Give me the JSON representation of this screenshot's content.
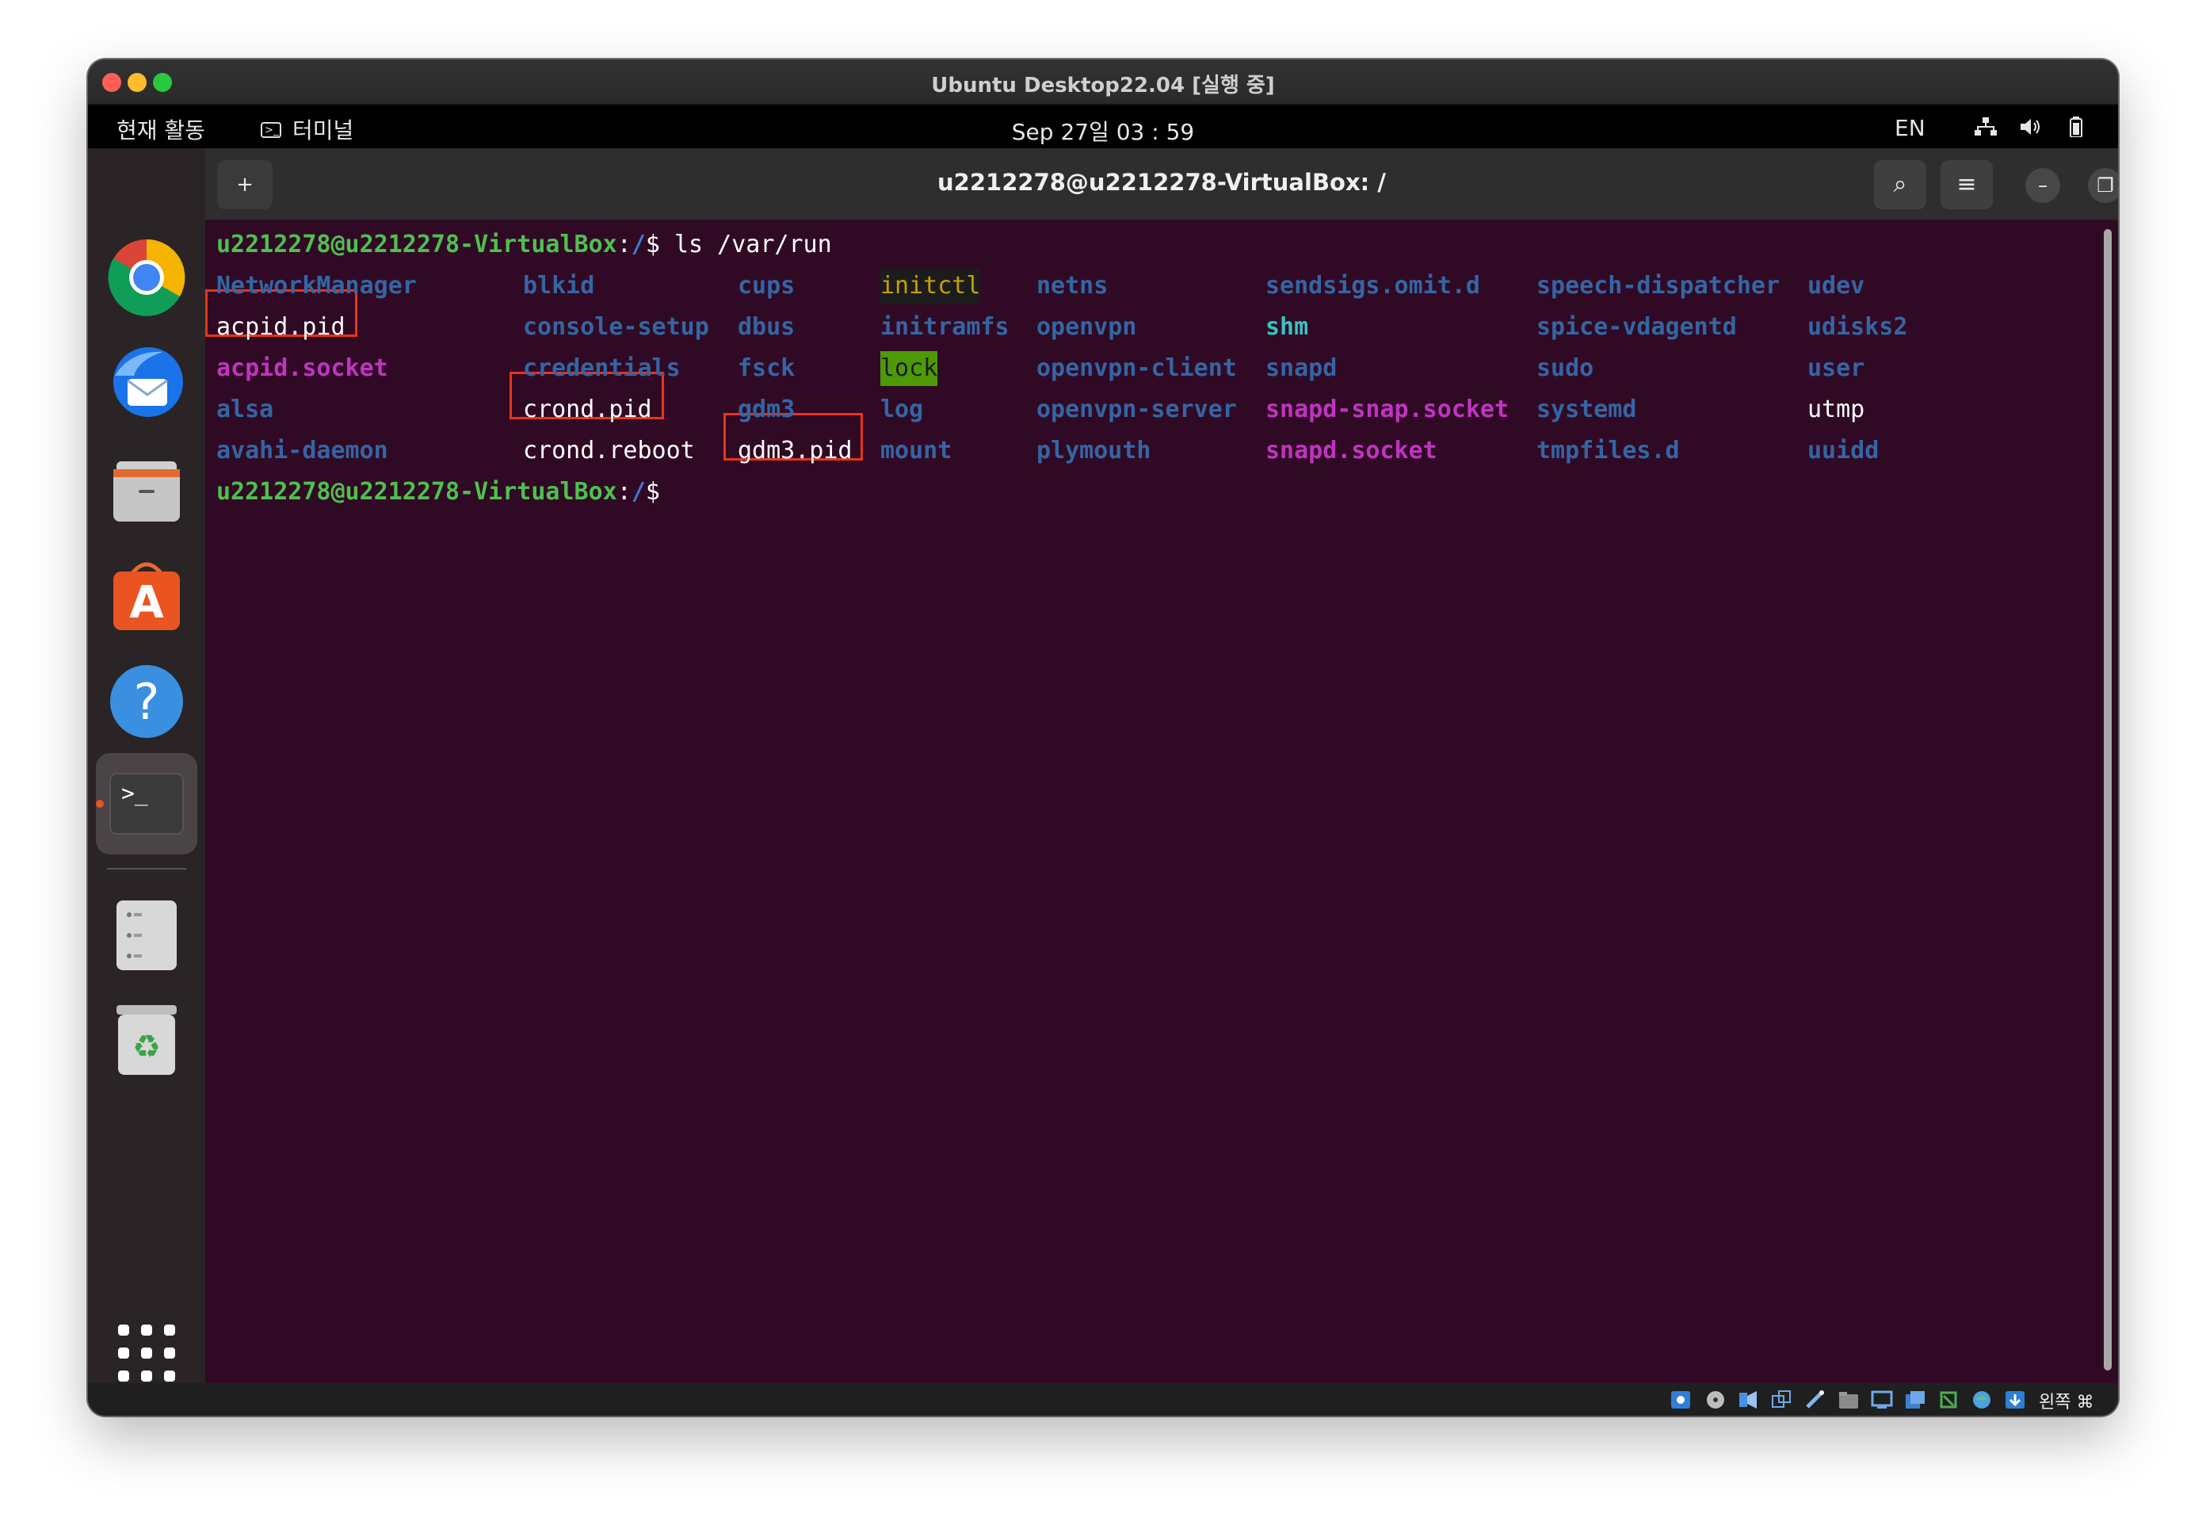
{
  "vm_window": {
    "title": "Ubuntu Desktop22.04 [실행 중]"
  },
  "topbar": {
    "activities": "현재 활동",
    "app_menu": "터미널",
    "app_menu_icon_glyph": ">_",
    "clock": "Sep 27일 03 : 59",
    "language": "EN",
    "tray_icons": [
      "network-icon",
      "volume-icon",
      "battery-icon"
    ]
  },
  "dock": {
    "items": [
      {
        "name": "Google Chrome",
        "icon": "chrome-icon"
      },
      {
        "name": "Thunderbird",
        "icon": "thunderbird-icon"
      },
      {
        "name": "Files",
        "icon": "files-icon"
      },
      {
        "name": "Ubuntu Software",
        "icon": "software-store-icon",
        "glyph": "A"
      },
      {
        "name": "Help",
        "icon": "help-icon",
        "glyph": "?"
      },
      {
        "name": "Terminal",
        "icon": "terminal-icon",
        "glyph": ">_",
        "active": true
      },
      {
        "name": "Storage",
        "icon": "storage-icon"
      },
      {
        "name": "Trash",
        "icon": "trash-icon",
        "glyph": "♻"
      },
      {
        "name": "Show Applications",
        "icon": "app-grid-icon"
      }
    ]
  },
  "terminal": {
    "title": "u2212278@u2212278-VirtualBox: /",
    "new_tab_glyph": "+",
    "search_glyph": "⌕",
    "menu_glyph": "≡",
    "minimize_glyph": "–",
    "restore_glyph": "❐",
    "close_glyph": "✕",
    "prompt_user": "u2212278@u2212278-VirtualBox",
    "prompt_colon": ":",
    "prompt_path": "/",
    "prompt_dollar": "$ ",
    "command": "ls /var/run",
    "listing": [
      [
        {
          "text": "NetworkManager",
          "type": "dir"
        },
        {
          "text": "acpid.pid",
          "type": "file",
          "highlighted": true
        },
        {
          "text": "acpid.socket",
          "type": "socket"
        },
        {
          "text": "alsa",
          "type": "dir"
        },
        {
          "text": "avahi-daemon",
          "type": "dir"
        }
      ],
      [
        {
          "text": "blkid",
          "type": "dir"
        },
        {
          "text": "console-setup",
          "type": "dir"
        },
        {
          "text": "credentials",
          "type": "dir"
        },
        {
          "text": "crond.pid",
          "type": "file",
          "highlighted": true
        },
        {
          "text": "crond.reboot",
          "type": "file"
        }
      ],
      [
        {
          "text": "cups",
          "type": "dir"
        },
        {
          "text": "dbus",
          "type": "dir"
        },
        {
          "text": "fsck",
          "type": "dir"
        },
        {
          "text": "gdm3",
          "type": "dir"
        },
        {
          "text": "gdm3.pid",
          "type": "file",
          "highlighted": true
        }
      ],
      [
        {
          "text": "initctl",
          "type": "fifo"
        },
        {
          "text": "initramfs",
          "type": "dir"
        },
        {
          "text": "lock",
          "type": "sticky"
        },
        {
          "text": "log",
          "type": "dir"
        },
        {
          "text": "mount",
          "type": "dir"
        }
      ],
      [
        {
          "text": "netns",
          "type": "dir"
        },
        {
          "text": "openvpn",
          "type": "dir"
        },
        {
          "text": "openvpn-client",
          "type": "dir"
        },
        {
          "text": "openvpn-server",
          "type": "dir"
        },
        {
          "text": "plymouth",
          "type": "dir"
        }
      ],
      [
        {
          "text": "sendsigs.omit.d",
          "type": "dir"
        },
        {
          "text": "shm",
          "type": "cyan"
        },
        {
          "text": "snapd",
          "type": "dir"
        },
        {
          "text": "snapd-snap.socket",
          "type": "socket"
        },
        {
          "text": "snapd.socket",
          "type": "socket"
        }
      ],
      [
        {
          "text": "speech-dispatcher",
          "type": "dir"
        },
        {
          "text": "spice-vdagentd",
          "type": "dir"
        },
        {
          "text": "sudo",
          "type": "dir"
        },
        {
          "text": "systemd",
          "type": "dir"
        },
        {
          "text": "tmpfiles.d",
          "type": "dir"
        }
      ],
      [
        {
          "text": "udev",
          "type": "dir"
        },
        {
          "text": "udisks2",
          "type": "dir"
        },
        {
          "text": "user",
          "type": "dir"
        },
        {
          "text": "utmp",
          "type": "file"
        },
        {
          "text": "uuidd",
          "type": "dir"
        }
      ]
    ]
  },
  "vbox_statusbar": {
    "host_key": "왼쪽 ⌘",
    "icons": [
      "hard-disk-icon",
      "optical-drive-icon",
      "audio-icon",
      "network-adapter-icon",
      "usb-icon",
      "shared-folder-icon",
      "display-icon",
      "recording-icon",
      "cpu-icon",
      "mouse-integration-icon",
      "keyboard-capture-icon"
    ]
  },
  "colors": {
    "terminal_bg": "#300a24",
    "prompt_green": "#4ec04e",
    "dir_blue": "#3465a4",
    "socket_magenta": "#c133c1",
    "highlight_red": "#e8341c",
    "ubuntu_orange": "#e95420"
  }
}
